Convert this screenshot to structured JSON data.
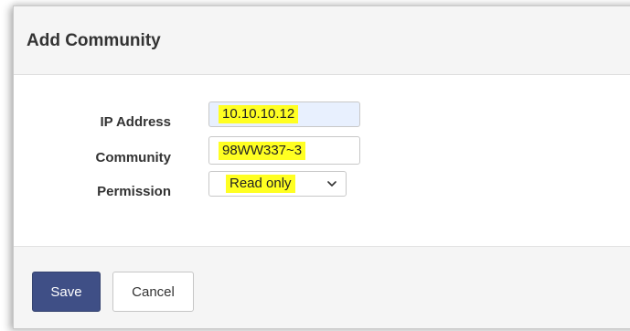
{
  "dialog": {
    "title": "Add Community"
  },
  "form": {
    "ip_address": {
      "label": "IP Address",
      "value": "10.10.10.12"
    },
    "community": {
      "label": "Community",
      "value": "98WW337~3"
    },
    "permission": {
      "label": "Permission",
      "selected": "Read only"
    }
  },
  "footer": {
    "save_label": "Save",
    "cancel_label": "Cancel"
  },
  "colors": {
    "primary_button": "#3f4f86",
    "highlight": "#ffff22",
    "autofill_background": "#e8f0fe"
  },
  "icons": {
    "select_caret": "chevron-down-icon"
  }
}
